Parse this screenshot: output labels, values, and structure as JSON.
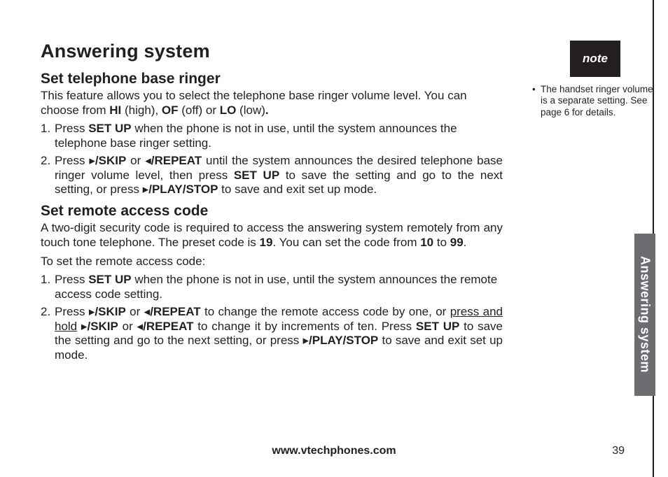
{
  "section_tab": "Answering system",
  "title": "Answering system",
  "sec1": {
    "heading": "Set telephone base ringer",
    "intro_a": "This feature allows you to select the telephone base ringer volume level. You can choose from ",
    "hi": "HI",
    "hi_after": " (high), ",
    "of": "OF",
    "of_after": " (off) or ",
    "lo": "LO",
    "lo_after": " (low)",
    "dot": ".",
    "s1_num": "1.",
    "s1_a": "Press ",
    "s1_setup": "SET UP",
    "s1_b": " when the phone is not in use, until the system announces the telephone base ringer setting.",
    "s2_num": "2.",
    "s2_a": "Press ",
    "s2_skip": "/SKIP",
    "s2_or1": " or ",
    "s2_repeat": "/REPEAT",
    "s2_b": " until the system announces the desired telephone base ringer volume level, then press ",
    "s2_setup": "SET UP",
    "s2_c": " to save the setting and go to the next setting, or press ",
    "s2_playstop": "/PLAY/STOP",
    "s2_d": " to save and exit set up mode."
  },
  "sec2": {
    "heading": "Set remote access code",
    "intro_a": "A two-digit security code is required to access the answering system remotely from any touch tone telephone. The preset code is ",
    "code19": "19",
    "intro_b": ". You can set the code from ",
    "code10": "10",
    "to": " to ",
    "code99": "99",
    "dot": ".",
    "intro2": "To set the remote access code:",
    "s1_num": "1.",
    "s1_a": "Press ",
    "s1_setup": "SET UP",
    "s1_b": " when the phone is not in use, until the system announces the remote access code setting.",
    "s2_num": "2.",
    "s2_a": "Press ",
    "s2_skip": "SKIP",
    "s2_or1": " or ",
    "s2_repeat": "REPEAT",
    "s2_b": " to change the remote access code by one, or ",
    "s2_hold": "press and hold",
    "s2_space": " ",
    "s2_skip2": "SKIP",
    "s2_or2": " or ",
    "s2_repeat2": "REPEAT",
    "s2_c": " to change it by increments of ten. ",
    "s2_press": "Press ",
    "s2_setup": "SET UP",
    "s2_d": " to save the setting and go to the next setting, or press ",
    "s2_playstop": "PLAY/STOP",
    "s2_e": " to save and exit set up mode."
  },
  "note": {
    "label": "note",
    "bullet": "•",
    "text": "The handset ringer volume is a separate setting. See page 6 for details."
  },
  "footer": {
    "url": "www.vtechphones.com",
    "page": "39"
  },
  "glyph": {
    "ff": "▸",
    "rw": "◂",
    "ps": "▸"
  }
}
